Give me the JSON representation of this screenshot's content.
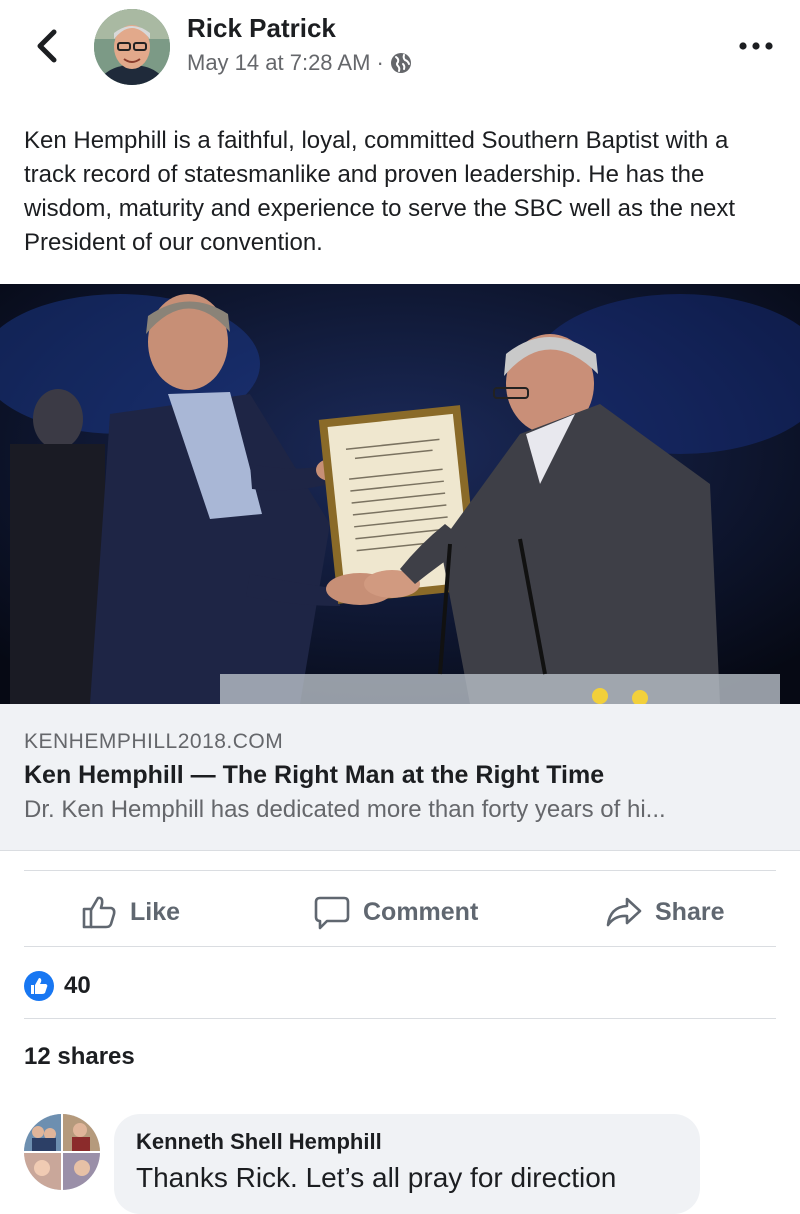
{
  "header": {
    "author": "Rick Patrick",
    "timestamp": "May 14 at 7:28 AM",
    "separator": "·",
    "back_icon": "chevron-left-icon",
    "privacy_icon": "globe-icon",
    "more_icon": "more-horizontal-icon"
  },
  "post": {
    "text": "Ken Hemphill is a faithful, loyal, committed Southern Baptist with a track record of statesmanlike and proven leadership. He has the wisdom, maturity and experience to serve the SBC well as the next President of our convention."
  },
  "link_preview": {
    "domain": "KENHEMPHILL2018.COM",
    "title": "Ken Hemphill — The Right Man at the Right Time",
    "description": "Dr. Ken Hemphill has dedicated more than forty years of hi..."
  },
  "actions": {
    "like": "Like",
    "comment": "Comment",
    "share": "Share"
  },
  "reactions": {
    "count": "40",
    "icon": "thumbs-up-icon"
  },
  "shares": "12 shares",
  "comment": {
    "author": "Kenneth Shell Hemphill",
    "text": "Thanks Rick. Let’s all pray for direction"
  },
  "colors": {
    "accent": "#1877f2",
    "secondary_text": "#65676b",
    "action_text": "#606770",
    "card_bg": "#f0f2f5"
  }
}
